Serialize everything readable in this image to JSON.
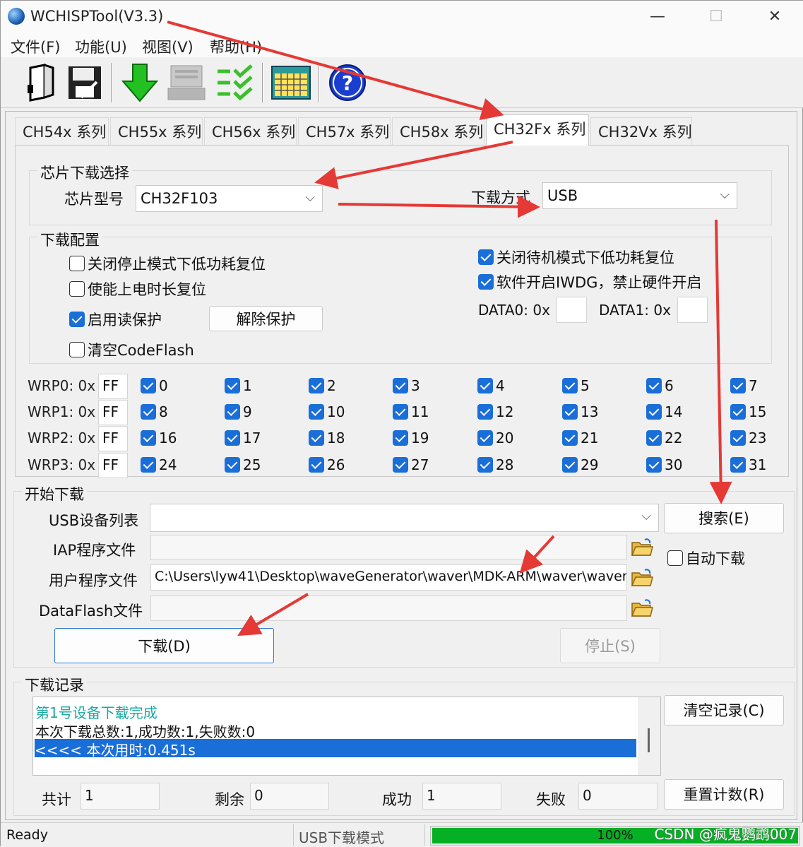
{
  "window": {
    "title": "WCHISPTool(V3.3)",
    "controls": [
      "—",
      "☐",
      "✕"
    ]
  },
  "menu": [
    "文件(F)",
    "功能(U)",
    "视图(V)",
    "帮助(H)"
  ],
  "toolbar": {
    "icons": [
      "open-file-icon",
      "save-icon",
      "download-icon",
      "device-icon",
      "checklist-icon",
      "calendar-grid-icon",
      "help-icon"
    ]
  },
  "tabs": [
    "CH54x 系列",
    "CH55x 系列",
    "CH56x 系列",
    "CH57x 系列",
    "CH58x 系列",
    "CH32Fx 系列",
    "CH32Vx 系列"
  ],
  "active_tab": "CH32Fx 系列",
  "chip_select": {
    "group_label": "芯片下载选择",
    "chip_model_label": "芯片型号",
    "chip_model_value": "CH32F103",
    "download_mode_label": "下载方式",
    "download_mode_value": "USB"
  },
  "download_config": {
    "group_label": "下载配置",
    "left_options": [
      {
        "label": "关闭停止模式下低功耗复位",
        "checked": false
      },
      {
        "label": "使能上电时长复位",
        "checked": false
      },
      {
        "label": "启用读保护",
        "checked": true
      },
      {
        "label": "清空CodeFlash",
        "checked": false
      }
    ],
    "remove_protect_button": "解除保护",
    "right_options": [
      {
        "label": "关闭待机模式下低功耗复位",
        "checked": true
      },
      {
        "label": "软件开启IWDG，禁止硬件开启",
        "checked": true
      }
    ],
    "data0_label": "DATA0: 0x",
    "data0_value": "",
    "data1_label": "DATA1: 0x",
    "data1_value": ""
  },
  "wrp": [
    {
      "label": "WRP0: 0x",
      "value": "FF",
      "bits": [
        "0",
        "1",
        "2",
        "3",
        "4",
        "5",
        "6",
        "7"
      ]
    },
    {
      "label": "WRP1: 0x",
      "value": "FF",
      "bits": [
        "8",
        "9",
        "10",
        "11",
        "12",
        "13",
        "14",
        "15"
      ]
    },
    {
      "label": "WRP2: 0x",
      "value": "FF",
      "bits": [
        "16",
        "17",
        "18",
        "19",
        "20",
        "21",
        "22",
        "23"
      ]
    },
    {
      "label": "WRP3: 0x",
      "value": "FF",
      "bits": [
        "24",
        "25",
        "26",
        "27",
        "28",
        "29",
        "30",
        "31"
      ]
    }
  ],
  "start_download": {
    "group_label": "开始下载",
    "usb_list_label": "USB设备列表",
    "usb_list_value": "",
    "search_button": "搜索(E)",
    "iap_label": "IAP程序文件",
    "iap_value": "",
    "auto_download_label": "自动下载",
    "auto_download_checked": false,
    "user_file_label": "用户程序文件",
    "user_file_value": "C:\\Users\\lyw41\\Desktop\\waveGenerator\\waver\\MDK-ARM\\waver\\waver",
    "dataflash_label": "DataFlash文件",
    "dataflash_value": "",
    "download_button": "下载(D)",
    "stop_button": "停止(S)"
  },
  "log": {
    "group_label": "下载记录",
    "lines": [
      {
        "text": "第1号设备下载完成",
        "color": "#1aa9a0"
      },
      {
        "text": "本次下载总数:1,成功数:1,失败数:0",
        "color": "#111111"
      },
      {
        "text": "<<<< 本次用时:0.451s",
        "color": "#ffffff"
      }
    ],
    "clear_button": "清空记录(C)"
  },
  "counters": {
    "total_label": "共计",
    "total_value": "1",
    "remaining_label": "剩余",
    "remaining_value": "0",
    "success_label": "成功",
    "success_value": "1",
    "fail_label": "失败",
    "fail_value": "0",
    "reset_button": "重置计数(R)"
  },
  "status": {
    "ready": "Ready",
    "mode": "USB下载模式",
    "progress_percent": 100,
    "progress_text": "100%"
  },
  "watermark": "CSDN @疯鬼鹦鹉007",
  "colors": {
    "accent": "#1a6ed8",
    "annotation_arrow": "#e53935",
    "progress": "#06b025"
  }
}
